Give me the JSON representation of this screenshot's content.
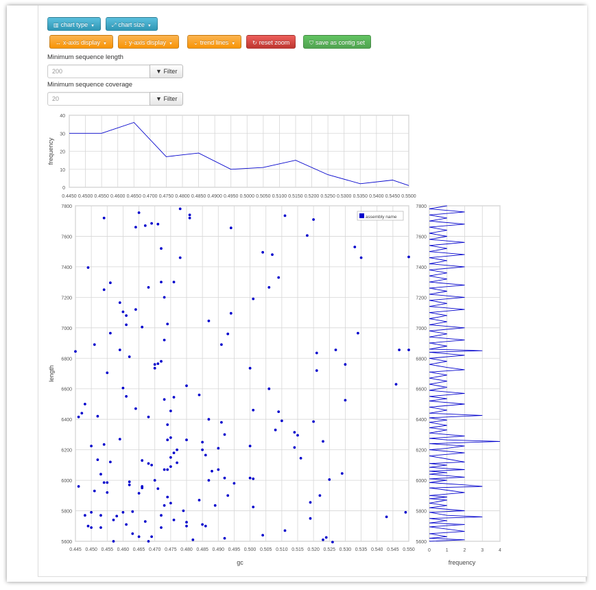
{
  "toolbar": {
    "chart_type": "chart type",
    "chart_size": "chart size",
    "x_axis_display": "x-axis display",
    "y_axis_display": "y-axis display",
    "trend_lines": "trend lines",
    "reset_zoom": "reset zoom",
    "save_as_contig_set": "save as contig set"
  },
  "filters": {
    "min_length_label": "Minimum sequence length",
    "min_length_value": "200",
    "min_coverage_label": "Minimum sequence coverage",
    "min_coverage_value": "20",
    "filter_button": "Filter"
  },
  "colors": {
    "series": "#0000cc",
    "grid": "#d6d6d6",
    "accent_info": "#49afcd",
    "accent_warning": "#faa732"
  },
  "chart_data": [
    {
      "type": "line",
      "ylabel": "frequency",
      "ylim": [
        0,
        40
      ],
      "yticks": [
        0,
        10,
        20,
        30,
        40
      ],
      "xlim": [
        0.445,
        0.55
      ],
      "xticks": [
        "0.4450",
        "0.4500",
        "0.4550",
        "0.4600",
        "0.4650",
        "0.4700",
        "0.4750",
        "0.4800",
        "0.4850",
        "0.4900",
        "0.4950",
        "0.5000",
        "0.5050",
        "0.5100",
        "0.5150",
        "0.5200",
        "0.5250",
        "0.5300",
        "0.5350",
        "0.5400",
        "0.5450",
        "0.5500"
      ],
      "x": [
        0.445,
        0.455,
        0.465,
        0.475,
        0.485,
        0.495,
        0.505,
        0.515,
        0.525,
        0.535,
        0.545,
        0.55
      ],
      "y": [
        30,
        30,
        36,
        17,
        19,
        10,
        11,
        15,
        7,
        2,
        4,
        1
      ],
      "grid": true
    },
    {
      "type": "scatter",
      "xlabel": "gc",
      "ylabel": "length",
      "xlim": [
        0.445,
        0.55
      ],
      "ylim": [
        5600,
        7800
      ],
      "xticks": [
        "0.445",
        "0.450",
        "0.455",
        "0.460",
        "0.465",
        "0.470",
        "0.475",
        "0.480",
        "0.485",
        "0.490",
        "0.495",
        "0.500",
        "0.505",
        "0.510",
        "0.515",
        "0.520",
        "0.525",
        "0.530",
        "0.535",
        "0.540",
        "0.545",
        "0.550"
      ],
      "yticks": [
        "5600",
        "5800",
        "6000",
        "6200",
        "6400",
        "6600",
        "6800",
        "7000",
        "7200",
        "7400",
        "7600",
        "7800"
      ],
      "legend": "assembly name",
      "legend_position": "top-right",
      "grid": true,
      "points": [
        [
          0.445,
          6845
        ],
        [
          0.446,
          6415
        ],
        [
          0.446,
          5960
        ],
        [
          0.447,
          6440
        ],
        [
          0.448,
          5770
        ],
        [
          0.448,
          6500
        ],
        [
          0.449,
          7395
        ],
        [
          0.449,
          5700
        ],
        [
          0.45,
          5790
        ],
        [
          0.45,
          6225
        ],
        [
          0.45,
          5690
        ],
        [
          0.451,
          6890
        ],
        [
          0.451,
          5930
        ],
        [
          0.452,
          6135
        ],
        [
          0.452,
          6420
        ],
        [
          0.453,
          6040
        ],
        [
          0.453,
          5770
        ],
        [
          0.453,
          5690
        ],
        [
          0.454,
          6235
        ],
        [
          0.454,
          5985
        ],
        [
          0.454,
          7250
        ],
        [
          0.454,
          7720
        ],
        [
          0.455,
          6705
        ],
        [
          0.455,
          5920
        ],
        [
          0.455,
          5985
        ],
        [
          0.456,
          6965
        ],
        [
          0.456,
          7295
        ],
        [
          0.456,
          6120
        ],
        [
          0.457,
          5740
        ],
        [
          0.457,
          5600
        ],
        [
          0.458,
          5765
        ],
        [
          0.459,
          6270
        ],
        [
          0.459,
          7165
        ],
        [
          0.459,
          6855
        ],
        [
          0.46,
          6605
        ],
        [
          0.46,
          7105
        ],
        [
          0.46,
          5790
        ],
        [
          0.461,
          5710
        ],
        [
          0.461,
          6550
        ],
        [
          0.461,
          7020
        ],
        [
          0.461,
          7080
        ],
        [
          0.462,
          5990
        ],
        [
          0.462,
          5970
        ],
        [
          0.462,
          6810
        ],
        [
          0.463,
          5795
        ],
        [
          0.463,
          5650
        ],
        [
          0.464,
          6470
        ],
        [
          0.464,
          7120
        ],
        [
          0.464,
          7660
        ],
        [
          0.465,
          5630
        ],
        [
          0.465,
          5915
        ],
        [
          0.465,
          7755
        ],
        [
          0.466,
          5960
        ],
        [
          0.466,
          5950
        ],
        [
          0.466,
          7005
        ],
        [
          0.466,
          6130
        ],
        [
          0.467,
          7670
        ],
        [
          0.467,
          5730
        ],
        [
          0.468,
          6110
        ],
        [
          0.468,
          7265
        ],
        [
          0.468,
          6415
        ],
        [
          0.468,
          5600
        ],
        [
          0.469,
          6100
        ],
        [
          0.469,
          7685
        ],
        [
          0.469,
          5630
        ],
        [
          0.47,
          6760
        ],
        [
          0.47,
          6735
        ],
        [
          0.47,
          6000
        ],
        [
          0.471,
          5945
        ],
        [
          0.471,
          6765
        ],
        [
          0.471,
          7680
        ],
        [
          0.472,
          5770
        ],
        [
          0.472,
          6780
        ],
        [
          0.472,
          7300
        ],
        [
          0.472,
          7520
        ],
        [
          0.472,
          5690
        ],
        [
          0.473,
          6530
        ],
        [
          0.473,
          6920
        ],
        [
          0.473,
          7200
        ],
        [
          0.473,
          6070
        ],
        [
          0.473,
          5835
        ],
        [
          0.474,
          6265
        ],
        [
          0.474,
          6365
        ],
        [
          0.474,
          6070
        ],
        [
          0.474,
          5890
        ],
        [
          0.474,
          7025
        ],
        [
          0.475,
          6280
        ],
        [
          0.475,
          6150
        ],
        [
          0.475,
          6090
        ],
        [
          0.475,
          5850
        ],
        [
          0.475,
          6455
        ],
        [
          0.476,
          6180
        ],
        [
          0.476,
          5740
        ],
        [
          0.476,
          6545
        ],
        [
          0.476,
          7300
        ],
        [
          0.477,
          6200
        ],
        [
          0.477,
          6115
        ],
        [
          0.478,
          7460
        ],
        [
          0.478,
          7780
        ],
        [
          0.479,
          5800
        ],
        [
          0.48,
          5700
        ],
        [
          0.48,
          6265
        ],
        [
          0.48,
          6620
        ],
        [
          0.48,
          5725
        ],
        [
          0.481,
          7740
        ],
        [
          0.481,
          7720
        ],
        [
          0.482,
          5610
        ],
        [
          0.484,
          6560
        ],
        [
          0.484,
          5870
        ],
        [
          0.485,
          6250
        ],
        [
          0.485,
          6200
        ],
        [
          0.485,
          5710
        ],
        [
          0.486,
          6165
        ],
        [
          0.486,
          5700
        ],
        [
          0.487,
          6400
        ],
        [
          0.487,
          6000
        ],
        [
          0.487,
          7045
        ],
        [
          0.488,
          6060
        ],
        [
          0.489,
          5835
        ],
        [
          0.49,
          6210
        ],
        [
          0.49,
          6070
        ],
        [
          0.491,
          6890
        ],
        [
          0.491,
          6380
        ],
        [
          0.492,
          6300
        ],
        [
          0.492,
          6015
        ],
        [
          0.492,
          5620
        ],
        [
          0.493,
          6960
        ],
        [
          0.493,
          5900
        ],
        [
          0.494,
          7095
        ],
        [
          0.494,
          7655
        ],
        [
          0.495,
          5980
        ],
        [
          0.5,
          6735
        ],
        [
          0.5,
          6225
        ],
        [
          0.5,
          6015
        ],
        [
          0.501,
          7190
        ],
        [
          0.501,
          6010
        ],
        [
          0.501,
          6460
        ],
        [
          0.501,
          5825
        ],
        [
          0.504,
          7495
        ],
        [
          0.504,
          5640
        ],
        [
          0.506,
          6600
        ],
        [
          0.506,
          7265
        ],
        [
          0.507,
          7480
        ],
        [
          0.508,
          6330
        ],
        [
          0.509,
          7330
        ],
        [
          0.509,
          6450
        ],
        [
          0.51,
          6390
        ],
        [
          0.511,
          5670
        ],
        [
          0.511,
          7735
        ],
        [
          0.514,
          6315
        ],
        [
          0.514,
          6215
        ],
        [
          0.515,
          6295
        ],
        [
          0.516,
          6145
        ],
        [
          0.518,
          7605
        ],
        [
          0.519,
          5855
        ],
        [
          0.519,
          5750
        ],
        [
          0.52,
          7710
        ],
        [
          0.52,
          6385
        ],
        [
          0.521,
          6835
        ],
        [
          0.521,
          6720
        ],
        [
          0.522,
          5900
        ],
        [
          0.523,
          5610
        ],
        [
          0.523,
          6255
        ],
        [
          0.524,
          5625
        ],
        [
          0.525,
          6005
        ],
        [
          0.526,
          5595
        ],
        [
          0.527,
          6855
        ],
        [
          0.529,
          6045
        ],
        [
          0.53,
          6760
        ],
        [
          0.53,
          6525
        ],
        [
          0.533,
          7530
        ],
        [
          0.534,
          6965
        ],
        [
          0.535,
          7460
        ],
        [
          0.543,
          5760
        ],
        [
          0.546,
          6630
        ],
        [
          0.547,
          6855
        ],
        [
          0.549,
          5790
        ],
        [
          0.55,
          7465
        ],
        [
          0.55,
          6855
        ]
      ]
    },
    {
      "type": "line",
      "orientation": "vertical",
      "xlabel": "frequency",
      "xlim": [
        0,
        4
      ],
      "xticks": [
        0,
        1,
        2,
        3,
        4
      ],
      "ylim": [
        5600,
        7800
      ],
      "yticks": [
        "5600",
        "5800",
        "6000",
        "6200",
        "6400",
        "6600",
        "6800",
        "7000",
        "7200",
        "7400",
        "7600",
        "7800"
      ],
      "grid": true,
      "y": [
        5600,
        5610,
        5620,
        5630,
        5650,
        5665,
        5680,
        5695,
        5710,
        5720,
        5735,
        5750,
        5760,
        5770,
        5790,
        5800,
        5820,
        5835,
        5850,
        5870,
        5880,
        5890,
        5900,
        5920,
        5935,
        5950,
        5960,
        5970,
        5985,
        6000,
        6010,
        6020,
        6040,
        6050,
        6060,
        6070,
        6085,
        6100,
        6110,
        6120,
        6140,
        6160,
        6180,
        6200,
        6210,
        6225,
        6240,
        6255,
        6265,
        6275,
        6290,
        6310,
        6330,
        6345,
        6360,
        6380,
        6395,
        6410,
        6425,
        6440,
        6460,
        6480,
        6500,
        6520,
        6535,
        6550,
        6570,
        6590,
        6610,
        6630,
        6650,
        6670,
        6690,
        6710,
        6725,
        6740,
        6760,
        6780,
        6800,
        6820,
        6840,
        6850,
        6860,
        6880,
        6900,
        6920,
        6940,
        6960,
        6980,
        7000,
        7020,
        7040,
        7060,
        7080,
        7100,
        7120,
        7140,
        7160,
        7180,
        7200,
        7220,
        7240,
        7260,
        7280,
        7300,
        7320,
        7340,
        7360,
        7380,
        7400,
        7420,
        7440,
        7460,
        7480,
        7500,
        7520,
        7540,
        7560,
        7580,
        7600,
        7620,
        7640,
        7660,
        7680,
        7700,
        7720,
        7740,
        7760,
        7780,
        7800
      ],
      "x": [
        0,
        2,
        0,
        1,
        0,
        2,
        1,
        0,
        2,
        0,
        1,
        0,
        3,
        1,
        0,
        2,
        0,
        1,
        0,
        1,
        0,
        1,
        0,
        2,
        1,
        0,
        3,
        2,
        0,
        1,
        0,
        2,
        0,
        1,
        0,
        2,
        0,
        1,
        0,
        2,
        1,
        0,
        2,
        0,
        1,
        2,
        0,
        4,
        1,
        0,
        2,
        0,
        1,
        0,
        1,
        0,
        1,
        0,
        3,
        0,
        1,
        0,
        2,
        0,
        1,
        0,
        2,
        0,
        1,
        0,
        1,
        0,
        1,
        0,
        2,
        1,
        0,
        1,
        0,
        2,
        0,
        3,
        0,
        1,
        0,
        2,
        0,
        1,
        0,
        2,
        0,
        1,
        0,
        1,
        0,
        2,
        0,
        1,
        0,
        2,
        0,
        1,
        0,
        2,
        0,
        1,
        0,
        1,
        0,
        2,
        0,
        1,
        0,
        2,
        0,
        1,
        0,
        2,
        0,
        1,
        0,
        1,
        0,
        2,
        0,
        1,
        0,
        2,
        0,
        1
      ]
    }
  ]
}
